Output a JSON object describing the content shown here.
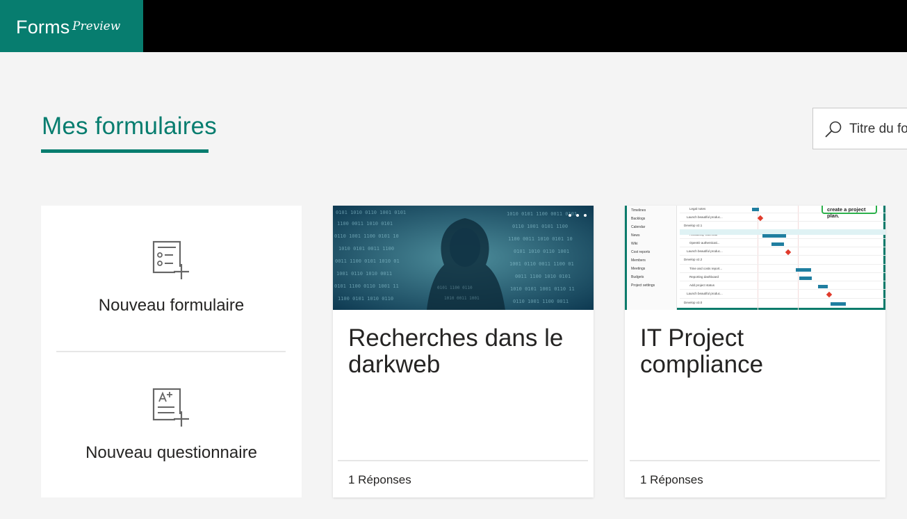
{
  "app": {
    "name": "Forms",
    "badge": "Preview"
  },
  "page": {
    "title": "Mes formulaires"
  },
  "search": {
    "placeholder": "Titre du formulaire"
  },
  "new_panel": {
    "new_form_label": "Nouveau formulaire",
    "new_quiz_label": "Nouveau questionnaire"
  },
  "cards": [
    {
      "title": "Recherches dans le darkweb",
      "responses": "1 Réponses"
    },
    {
      "title": "IT Project compliance",
      "responses": "1 Réponses"
    }
  ],
  "gantt_thumb": {
    "callout": "create a project plan.",
    "nav": [
      "Timelines",
      "Backlogs",
      "Calendar",
      "News",
      "Wiki",
      "Cost reports",
      "Members",
      "Meetings",
      "Budgets",
      "Project settings"
    ],
    "tasks": [
      "Legal notes",
      "Launch beautiful produc...",
      "Develop v2.1",
      "Availability Calendar",
      "OpenID authenticati...",
      "Launch beautiful produc...",
      "Develop v2.2",
      "Time and costs report...",
      "Reporting dashboard",
      "Add project status",
      "Launch beautiful produc...",
      "Develop v3.0"
    ]
  },
  "colors": {
    "brand": "#077d6f",
    "topbar": "#000000",
    "background": "#f4f4f4"
  }
}
